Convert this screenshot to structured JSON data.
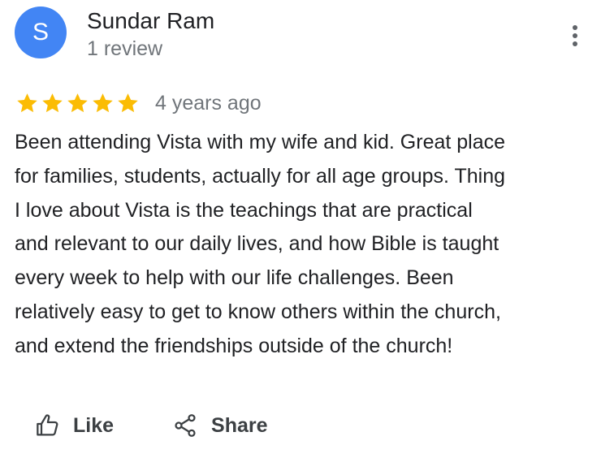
{
  "reviewer": {
    "avatar_initial": "S",
    "avatar_color": "#4285f4",
    "name": "Sundar Ram",
    "review_count": "1 review"
  },
  "rating": {
    "stars": 5,
    "max_stars": 5,
    "star_color": "#fbbc04",
    "date": "4 years ago"
  },
  "review": {
    "text": "Been attending Vista with my wife and kid. Great place\nfor families, students, actually for all age groups. Thing\nI love about Vista is the teachings that are practical\nand relevant to our daily lives, and how Bible is taught\nevery week to help with our life challenges.  Been\nrelatively easy to get to know others within the church,\nand extend the friendships outside of the church!"
  },
  "actions": {
    "like_label": "Like",
    "like_icon": "thumb-up-icon",
    "share_label": "Share",
    "share_icon": "share-icon",
    "more_icon": "more-vert-icon"
  }
}
